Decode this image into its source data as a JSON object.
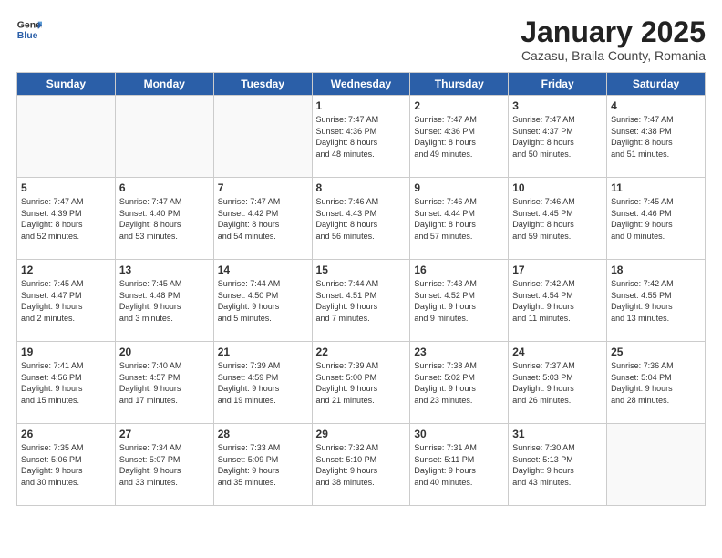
{
  "header": {
    "logo_general": "General",
    "logo_blue": "Blue",
    "title": "January 2025",
    "subtitle": "Cazasu, Braila County, Romania"
  },
  "days": [
    "Sunday",
    "Monday",
    "Tuesday",
    "Wednesday",
    "Thursday",
    "Friday",
    "Saturday"
  ],
  "weeks": [
    [
      {
        "date": "",
        "info": ""
      },
      {
        "date": "",
        "info": ""
      },
      {
        "date": "",
        "info": ""
      },
      {
        "date": "1",
        "info": "Sunrise: 7:47 AM\nSunset: 4:36 PM\nDaylight: 8 hours\nand 48 minutes."
      },
      {
        "date": "2",
        "info": "Sunrise: 7:47 AM\nSunset: 4:36 PM\nDaylight: 8 hours\nand 49 minutes."
      },
      {
        "date": "3",
        "info": "Sunrise: 7:47 AM\nSunset: 4:37 PM\nDaylight: 8 hours\nand 50 minutes."
      },
      {
        "date": "4",
        "info": "Sunrise: 7:47 AM\nSunset: 4:38 PM\nDaylight: 8 hours\nand 51 minutes."
      }
    ],
    [
      {
        "date": "5",
        "info": "Sunrise: 7:47 AM\nSunset: 4:39 PM\nDaylight: 8 hours\nand 52 minutes."
      },
      {
        "date": "6",
        "info": "Sunrise: 7:47 AM\nSunset: 4:40 PM\nDaylight: 8 hours\nand 53 minutes."
      },
      {
        "date": "7",
        "info": "Sunrise: 7:47 AM\nSunset: 4:42 PM\nDaylight: 8 hours\nand 54 minutes."
      },
      {
        "date": "8",
        "info": "Sunrise: 7:46 AM\nSunset: 4:43 PM\nDaylight: 8 hours\nand 56 minutes."
      },
      {
        "date": "9",
        "info": "Sunrise: 7:46 AM\nSunset: 4:44 PM\nDaylight: 8 hours\nand 57 minutes."
      },
      {
        "date": "10",
        "info": "Sunrise: 7:46 AM\nSunset: 4:45 PM\nDaylight: 8 hours\nand 59 minutes."
      },
      {
        "date": "11",
        "info": "Sunrise: 7:45 AM\nSunset: 4:46 PM\nDaylight: 9 hours\nand 0 minutes."
      }
    ],
    [
      {
        "date": "12",
        "info": "Sunrise: 7:45 AM\nSunset: 4:47 PM\nDaylight: 9 hours\nand 2 minutes."
      },
      {
        "date": "13",
        "info": "Sunrise: 7:45 AM\nSunset: 4:48 PM\nDaylight: 9 hours\nand 3 minutes."
      },
      {
        "date": "14",
        "info": "Sunrise: 7:44 AM\nSunset: 4:50 PM\nDaylight: 9 hours\nand 5 minutes."
      },
      {
        "date": "15",
        "info": "Sunrise: 7:44 AM\nSunset: 4:51 PM\nDaylight: 9 hours\nand 7 minutes."
      },
      {
        "date": "16",
        "info": "Sunrise: 7:43 AM\nSunset: 4:52 PM\nDaylight: 9 hours\nand 9 minutes."
      },
      {
        "date": "17",
        "info": "Sunrise: 7:42 AM\nSunset: 4:54 PM\nDaylight: 9 hours\nand 11 minutes."
      },
      {
        "date": "18",
        "info": "Sunrise: 7:42 AM\nSunset: 4:55 PM\nDaylight: 9 hours\nand 13 minutes."
      }
    ],
    [
      {
        "date": "19",
        "info": "Sunrise: 7:41 AM\nSunset: 4:56 PM\nDaylight: 9 hours\nand 15 minutes."
      },
      {
        "date": "20",
        "info": "Sunrise: 7:40 AM\nSunset: 4:57 PM\nDaylight: 9 hours\nand 17 minutes."
      },
      {
        "date": "21",
        "info": "Sunrise: 7:39 AM\nSunset: 4:59 PM\nDaylight: 9 hours\nand 19 minutes."
      },
      {
        "date": "22",
        "info": "Sunrise: 7:39 AM\nSunset: 5:00 PM\nDaylight: 9 hours\nand 21 minutes."
      },
      {
        "date": "23",
        "info": "Sunrise: 7:38 AM\nSunset: 5:02 PM\nDaylight: 9 hours\nand 23 minutes."
      },
      {
        "date": "24",
        "info": "Sunrise: 7:37 AM\nSunset: 5:03 PM\nDaylight: 9 hours\nand 26 minutes."
      },
      {
        "date": "25",
        "info": "Sunrise: 7:36 AM\nSunset: 5:04 PM\nDaylight: 9 hours\nand 28 minutes."
      }
    ],
    [
      {
        "date": "26",
        "info": "Sunrise: 7:35 AM\nSunset: 5:06 PM\nDaylight: 9 hours\nand 30 minutes."
      },
      {
        "date": "27",
        "info": "Sunrise: 7:34 AM\nSunset: 5:07 PM\nDaylight: 9 hours\nand 33 minutes."
      },
      {
        "date": "28",
        "info": "Sunrise: 7:33 AM\nSunset: 5:09 PM\nDaylight: 9 hours\nand 35 minutes."
      },
      {
        "date": "29",
        "info": "Sunrise: 7:32 AM\nSunset: 5:10 PM\nDaylight: 9 hours\nand 38 minutes."
      },
      {
        "date": "30",
        "info": "Sunrise: 7:31 AM\nSunset: 5:11 PM\nDaylight: 9 hours\nand 40 minutes."
      },
      {
        "date": "31",
        "info": "Sunrise: 7:30 AM\nSunset: 5:13 PM\nDaylight: 9 hours\nand 43 minutes."
      },
      {
        "date": "",
        "info": ""
      }
    ]
  ]
}
